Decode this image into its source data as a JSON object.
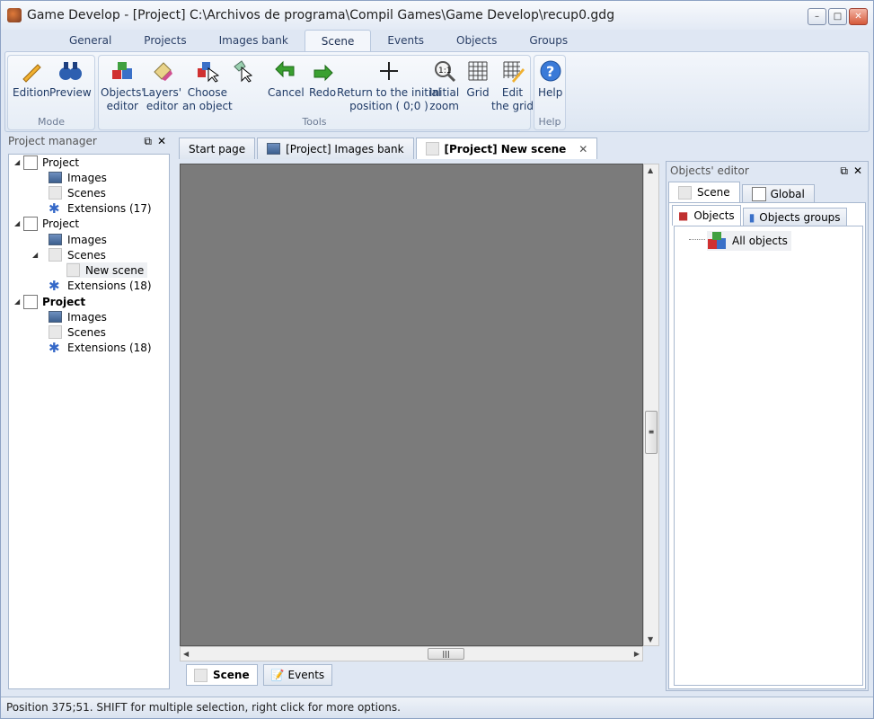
{
  "window": {
    "title": "Game Develop - [Project] C:\\Archivos de programa\\Compil Games\\Game Develop\\recup0.gdg",
    "min_label": "–",
    "max_label": "□",
    "close_label": "✕"
  },
  "ribbon_tabs": [
    "General",
    "Projects",
    "Images bank",
    "Scene",
    "Events",
    "Objects",
    "Groups"
  ],
  "ribbon": {
    "mode": {
      "label": "Mode",
      "edition": "Edition",
      "preview": "Preview"
    },
    "tools": {
      "label": "Tools",
      "objects_editor": [
        "Objects'",
        "editor"
      ],
      "layers_editor": [
        "Layers'",
        "editor"
      ],
      "choose_object": [
        "Choose",
        "an object"
      ],
      "cancel": "Cancel",
      "redo": "Redo",
      "return_initial": [
        "Return to the initial",
        "position ( 0;0 )"
      ],
      "initial_zoom": [
        "Initial",
        "zoom"
      ],
      "grid": "Grid",
      "edit_grid": [
        "Edit",
        "the grid"
      ]
    },
    "help": {
      "label": "Help",
      "help": "Help"
    }
  },
  "project_manager": {
    "title": "Project manager",
    "nodes": [
      {
        "label": "Project",
        "children": [
          "Images",
          "Scenes",
          "Extensions (17)"
        ]
      },
      {
        "label": "Project",
        "children": [
          "Images",
          "Scenes",
          "New scene",
          "Extensions (18)"
        ]
      },
      {
        "label": "Project",
        "children": [
          "Images",
          "Scenes",
          "Extensions (18)"
        ]
      }
    ]
  },
  "doc_tabs": [
    "Start page",
    "[Project] Images bank",
    "[Project] New scene"
  ],
  "bottom_tabs": [
    "Scene",
    "Events"
  ],
  "objects_editor": {
    "title": "Objects' editor",
    "tabs": [
      "Scene",
      "Global"
    ],
    "subtabs": [
      "Objects",
      "Objects groups"
    ],
    "root": "All objects"
  },
  "status": "Position 375;51. SHIFT for multiple selection, right click for more options.",
  "colors": {
    "canvas": "#7b7b7b",
    "accent": "#3468c8"
  }
}
